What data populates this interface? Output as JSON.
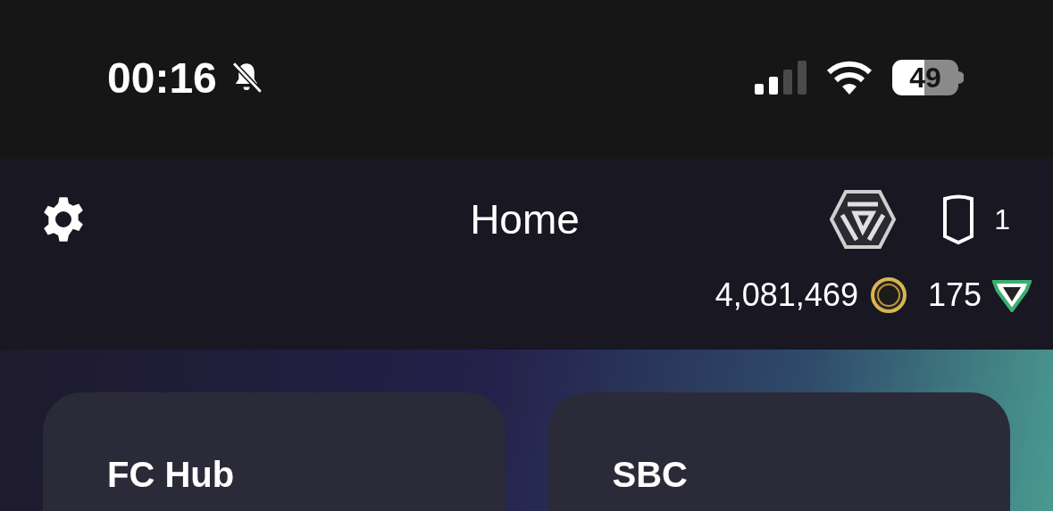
{
  "status_bar": {
    "time": "00:16",
    "battery": "49"
  },
  "header": {
    "title": "Home",
    "pack_count": "1"
  },
  "currency": {
    "coins": "4,081,469",
    "points": "175"
  },
  "tiles": [
    {
      "title": "FC Hub"
    },
    {
      "title": "SBC"
    }
  ]
}
